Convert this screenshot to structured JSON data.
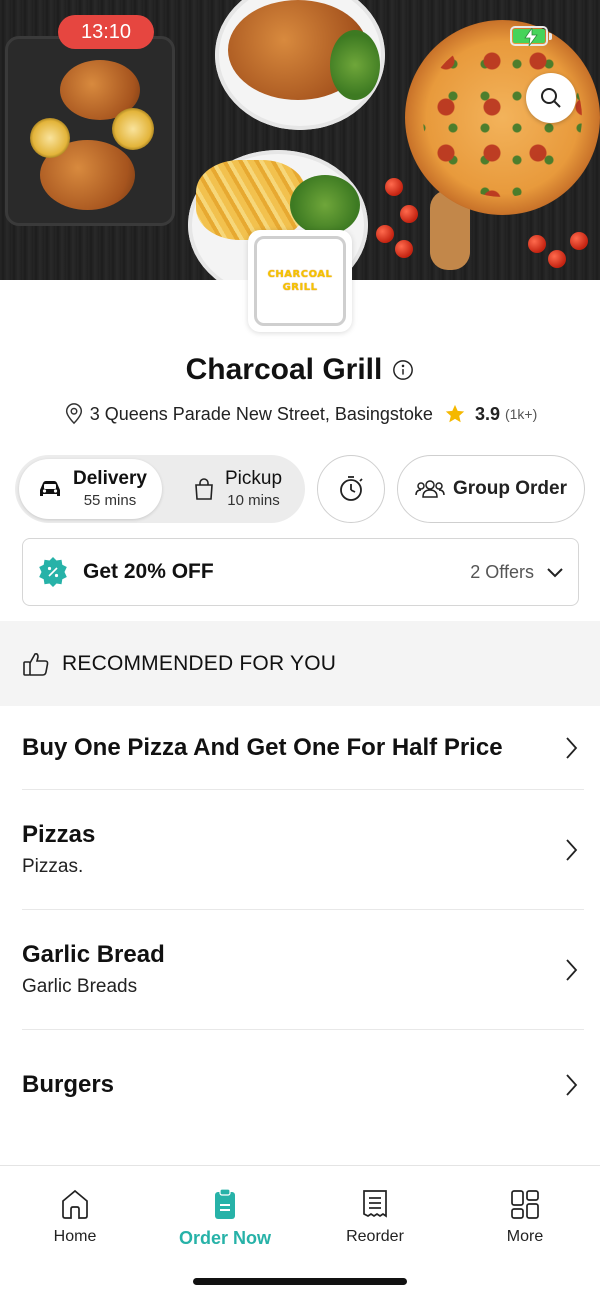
{
  "status_bar": {
    "time": "13:10"
  },
  "restaurant": {
    "logo_text": "CHARCOAL GRILL",
    "name": "Charcoal Grill",
    "address": "3 Queens Parade New Street, Basingstoke",
    "rating": "3.9",
    "rating_count": "(1k+)"
  },
  "order_modes": {
    "delivery": {
      "label": "Delivery",
      "time": "55 mins",
      "selected": true
    },
    "pickup": {
      "label": "Pickup",
      "time": "10 mins",
      "selected": false
    },
    "group_order_label": "Group Order"
  },
  "offer": {
    "title": "Get 20% OFF",
    "count_label": "2 Offers"
  },
  "recommended": {
    "title": "RECOMMENDED FOR YOU"
  },
  "menu": [
    {
      "title": "Buy One Pizza And Get One For Half Price",
      "description": ""
    },
    {
      "title": "Pizzas",
      "description": "Pizzas."
    },
    {
      "title": "Garlic Bread",
      "description": "Garlic Breads"
    },
    {
      "title": "Burgers",
      "description": ""
    }
  ],
  "bottom_nav": [
    {
      "label": "Home",
      "icon": "home-icon",
      "active": false
    },
    {
      "label": "Order Now",
      "icon": "order-now-icon",
      "active": true
    },
    {
      "label": "Reorder",
      "icon": "receipt-icon",
      "active": false
    },
    {
      "label": "More",
      "icon": "grid-icon",
      "active": false
    }
  ],
  "colors": {
    "accent_teal": "#27b2a8",
    "time_pill": "#e64640",
    "rating_star": "#f5b800",
    "battery": "#46d35a"
  }
}
